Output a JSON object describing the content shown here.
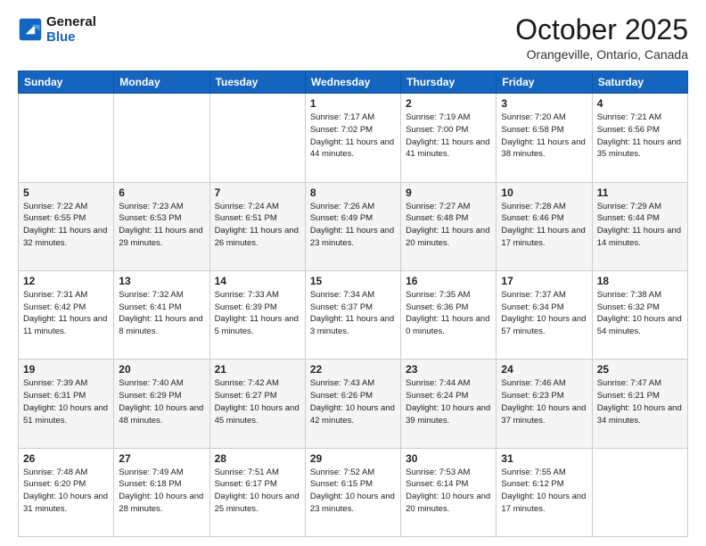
{
  "header": {
    "logo_line1": "General",
    "logo_line2": "Blue",
    "title": "October 2025",
    "subtitle": "Orangeville, Ontario, Canada"
  },
  "weekdays": [
    "Sunday",
    "Monday",
    "Tuesday",
    "Wednesday",
    "Thursday",
    "Friday",
    "Saturday"
  ],
  "weeks": [
    [
      {
        "day": "",
        "sunrise": "",
        "sunset": "",
        "daylight": ""
      },
      {
        "day": "",
        "sunrise": "",
        "sunset": "",
        "daylight": ""
      },
      {
        "day": "",
        "sunrise": "",
        "sunset": "",
        "daylight": ""
      },
      {
        "day": "1",
        "sunrise": "7:17 AM",
        "sunset": "7:02 PM",
        "daylight": "11 hours and 44 minutes."
      },
      {
        "day": "2",
        "sunrise": "7:19 AM",
        "sunset": "7:00 PM",
        "daylight": "11 hours and 41 minutes."
      },
      {
        "day": "3",
        "sunrise": "7:20 AM",
        "sunset": "6:58 PM",
        "daylight": "11 hours and 38 minutes."
      },
      {
        "day": "4",
        "sunrise": "7:21 AM",
        "sunset": "6:56 PM",
        "daylight": "11 hours and 35 minutes."
      }
    ],
    [
      {
        "day": "5",
        "sunrise": "7:22 AM",
        "sunset": "6:55 PM",
        "daylight": "11 hours and 32 minutes."
      },
      {
        "day": "6",
        "sunrise": "7:23 AM",
        "sunset": "6:53 PM",
        "daylight": "11 hours and 29 minutes."
      },
      {
        "day": "7",
        "sunrise": "7:24 AM",
        "sunset": "6:51 PM",
        "daylight": "11 hours and 26 minutes."
      },
      {
        "day": "8",
        "sunrise": "7:26 AM",
        "sunset": "6:49 PM",
        "daylight": "11 hours and 23 minutes."
      },
      {
        "day": "9",
        "sunrise": "7:27 AM",
        "sunset": "6:48 PM",
        "daylight": "11 hours and 20 minutes."
      },
      {
        "day": "10",
        "sunrise": "7:28 AM",
        "sunset": "6:46 PM",
        "daylight": "11 hours and 17 minutes."
      },
      {
        "day": "11",
        "sunrise": "7:29 AM",
        "sunset": "6:44 PM",
        "daylight": "11 hours and 14 minutes."
      }
    ],
    [
      {
        "day": "12",
        "sunrise": "7:31 AM",
        "sunset": "6:42 PM",
        "daylight": "11 hours and 11 minutes."
      },
      {
        "day": "13",
        "sunrise": "7:32 AM",
        "sunset": "6:41 PM",
        "daylight": "11 hours and 8 minutes."
      },
      {
        "day": "14",
        "sunrise": "7:33 AM",
        "sunset": "6:39 PM",
        "daylight": "11 hours and 5 minutes."
      },
      {
        "day": "15",
        "sunrise": "7:34 AM",
        "sunset": "6:37 PM",
        "daylight": "11 hours and 3 minutes."
      },
      {
        "day": "16",
        "sunrise": "7:35 AM",
        "sunset": "6:36 PM",
        "daylight": "11 hours and 0 minutes."
      },
      {
        "day": "17",
        "sunrise": "7:37 AM",
        "sunset": "6:34 PM",
        "daylight": "10 hours and 57 minutes."
      },
      {
        "day": "18",
        "sunrise": "7:38 AM",
        "sunset": "6:32 PM",
        "daylight": "10 hours and 54 minutes."
      }
    ],
    [
      {
        "day": "19",
        "sunrise": "7:39 AM",
        "sunset": "6:31 PM",
        "daylight": "10 hours and 51 minutes."
      },
      {
        "day": "20",
        "sunrise": "7:40 AM",
        "sunset": "6:29 PM",
        "daylight": "10 hours and 48 minutes."
      },
      {
        "day": "21",
        "sunrise": "7:42 AM",
        "sunset": "6:27 PM",
        "daylight": "10 hours and 45 minutes."
      },
      {
        "day": "22",
        "sunrise": "7:43 AM",
        "sunset": "6:26 PM",
        "daylight": "10 hours and 42 minutes."
      },
      {
        "day": "23",
        "sunrise": "7:44 AM",
        "sunset": "6:24 PM",
        "daylight": "10 hours and 39 minutes."
      },
      {
        "day": "24",
        "sunrise": "7:46 AM",
        "sunset": "6:23 PM",
        "daylight": "10 hours and 37 minutes."
      },
      {
        "day": "25",
        "sunrise": "7:47 AM",
        "sunset": "6:21 PM",
        "daylight": "10 hours and 34 minutes."
      }
    ],
    [
      {
        "day": "26",
        "sunrise": "7:48 AM",
        "sunset": "6:20 PM",
        "daylight": "10 hours and 31 minutes."
      },
      {
        "day": "27",
        "sunrise": "7:49 AM",
        "sunset": "6:18 PM",
        "daylight": "10 hours and 28 minutes."
      },
      {
        "day": "28",
        "sunrise": "7:51 AM",
        "sunset": "6:17 PM",
        "daylight": "10 hours and 25 minutes."
      },
      {
        "day": "29",
        "sunrise": "7:52 AM",
        "sunset": "6:15 PM",
        "daylight": "10 hours and 23 minutes."
      },
      {
        "day": "30",
        "sunrise": "7:53 AM",
        "sunset": "6:14 PM",
        "daylight": "10 hours and 20 minutes."
      },
      {
        "day": "31",
        "sunrise": "7:55 AM",
        "sunset": "6:12 PM",
        "daylight": "10 hours and 17 minutes."
      },
      {
        "day": "",
        "sunrise": "",
        "sunset": "",
        "daylight": ""
      }
    ]
  ]
}
